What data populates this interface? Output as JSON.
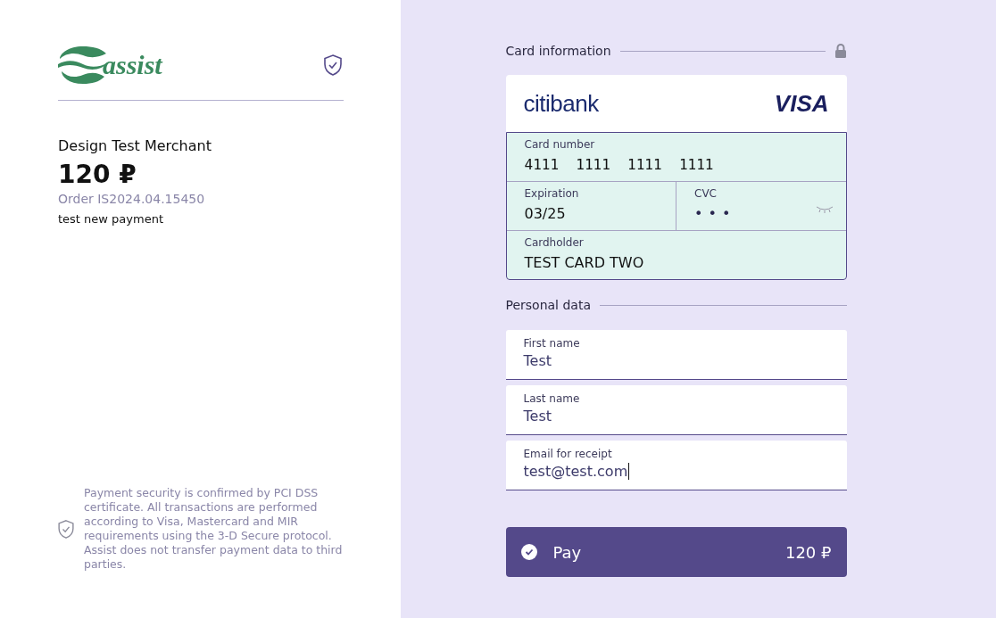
{
  "brand": {
    "logo": "assist"
  },
  "merchant": {
    "name": "Design Test Merchant",
    "amount": "120 ₽",
    "order": "Order IS2024.04.15450",
    "description": "test new payment"
  },
  "security_note": "Payment security is confirmed by PCI DSS certificate. All transactions are performed according to Visa, Mastercard and MIR requirements using the 3-D Secure protocol. Assist does not transfer payment data to third parties.",
  "card_section": {
    "title": "Card information",
    "bank": "citibank",
    "network": "VISA",
    "fields": [
      {
        "label": "Card number",
        "value": "4111  1111  1111  1111",
        "kind": "number"
      },
      {
        "label": "Expiration",
        "value": "03/25",
        "kind": "text"
      },
      {
        "label": "CVC",
        "value": "•••",
        "kind": "secret"
      },
      {
        "label": "Cardholder",
        "value": "TEST CARD TWO",
        "kind": "text"
      }
    ]
  },
  "personal_section": {
    "title": "Personal data",
    "fields": [
      {
        "label": "First name",
        "value": "Test",
        "focused": false
      },
      {
        "label": "Last name",
        "value": "Test",
        "focused": false
      },
      {
        "label": "Email for receipt",
        "value": "test@test.com",
        "focused": true
      }
    ]
  },
  "pay_button": {
    "label": "Pay",
    "amount": "120 ₽"
  }
}
